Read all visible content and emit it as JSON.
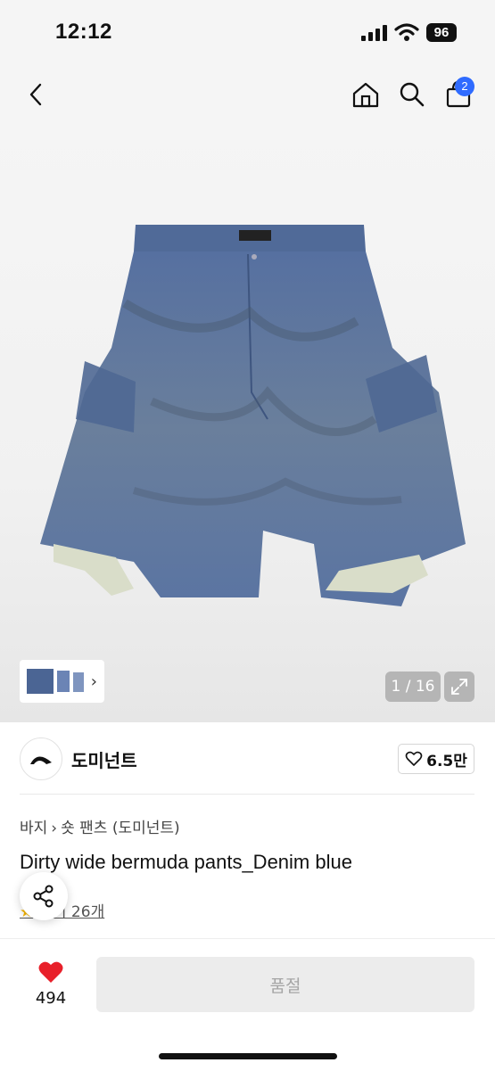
{
  "status_bar": {
    "time": "12:12",
    "battery": "96"
  },
  "nav": {
    "cart_badge": "2"
  },
  "gallery": {
    "counter": "1 / 16"
  },
  "brand": {
    "name": "도미넌트",
    "likes": "6.5만"
  },
  "breadcrumb": {
    "category": "바지",
    "subcategory": "숏 팬츠 (도미넌트)"
  },
  "product": {
    "title": "Dirty wide bermuda pants_Denim blue",
    "reviews": "후기 26개"
  },
  "bottom": {
    "wish_count": "494",
    "buy_label": "품절"
  },
  "colors": {
    "accent": "#2f6bff",
    "heart": "#e8202a",
    "disabled_bg": "#ececec",
    "disabled_text": "#a5a5a5",
    "denim": "#5570a0"
  }
}
